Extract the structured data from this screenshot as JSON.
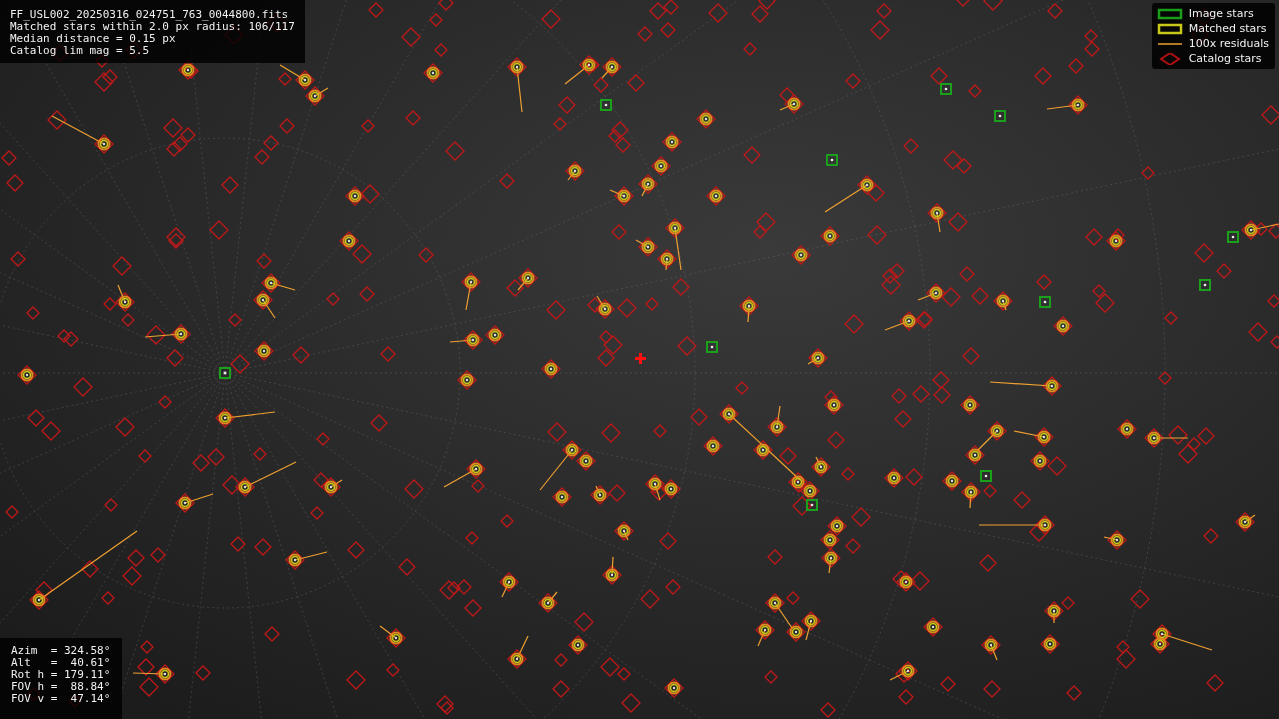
{
  "info_panel": {
    "lines": [
      "FF_USL002_20250316_024751_763_0044800.fits",
      "Matched stars within 2.0 px radius: 106/117",
      "Median distance = 0.15 px",
      "Catalog lim mag = 5.5"
    ]
  },
  "legend": [
    {
      "kind": "image",
      "label": "Image stars"
    },
    {
      "kind": "matched",
      "label": "Matched stars"
    },
    {
      "kind": "residual",
      "label": "100x residuals"
    },
    {
      "kind": "catalog",
      "label": "Catalog stars"
    }
  ],
  "pointing_panel": {
    "lines": [
      "Azim  = 324.58°",
      "Alt   =  40.61°",
      "Rot h = 179.11°",
      "FOV h =  88.84°",
      "FOV v =  47.14°"
    ]
  }
}
